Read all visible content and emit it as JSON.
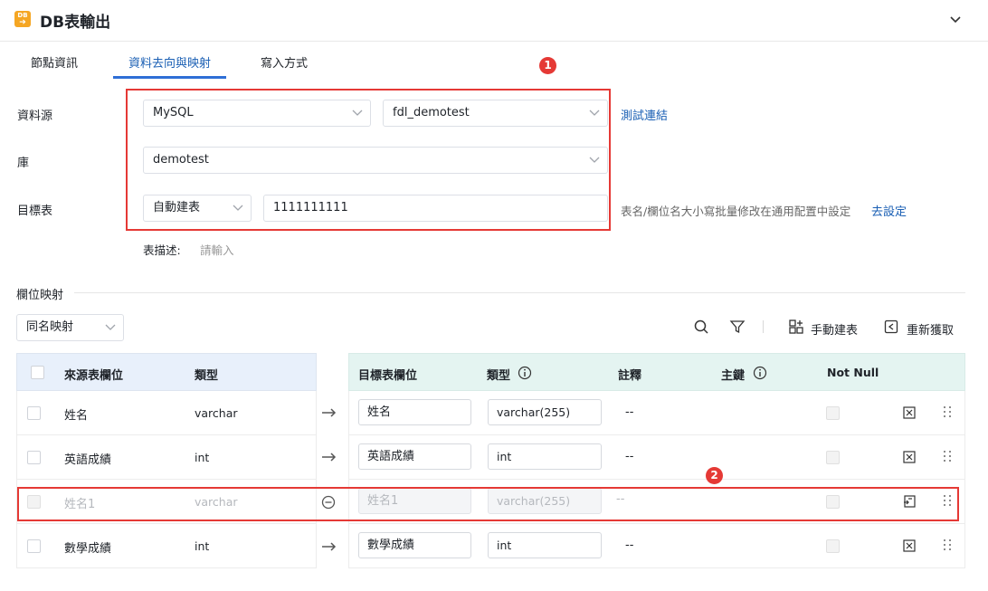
{
  "header": {
    "title": "DB表輸出",
    "logo_text": "DB"
  },
  "tabs": [
    {
      "label": "節點資訊"
    },
    {
      "label": "資料去向與映射"
    },
    {
      "label": "寫入方式"
    }
  ],
  "badges": [
    "1",
    "2"
  ],
  "form": {
    "datasource_label": "資料源",
    "datasource_type": "MySQL",
    "datasource_conn": "fdl_demotest",
    "test_link": "測試連結",
    "db_label": "庫",
    "db_value": "demotest",
    "target_label": "目標表",
    "target_mode": "自動建表",
    "target_name": "1111111111",
    "hint": "表名/欄位名大小寫批量修改在通用配置中設定",
    "goto_link": "去設定",
    "desc_label": "表描述:",
    "desc_placeholder": "請輸入"
  },
  "mapping": {
    "section_title": "欄位映射",
    "mode": "同名映射",
    "manual_create": "手動建表",
    "refetch": "重新獲取"
  },
  "source_table": {
    "headers": [
      "來源表欄位",
      "類型"
    ],
    "rows": [
      {
        "field": "姓名",
        "type": "varchar"
      },
      {
        "field": "英語成績",
        "type": "int"
      },
      {
        "field": "姓名1",
        "type": "varchar"
      },
      {
        "field": "數學成績",
        "type": "int"
      }
    ]
  },
  "target_table": {
    "headers": [
      "目標表欄位",
      "類型",
      "註釋",
      "主鍵",
      "Not Null"
    ],
    "rows": [
      {
        "field": "姓名",
        "type": "varchar(255)",
        "comment": "--"
      },
      {
        "field": "英語成績",
        "type": "int",
        "comment": "--"
      },
      {
        "field": "姓名1",
        "type": "varchar(255)",
        "comment": "--"
      },
      {
        "field": "數學成績",
        "type": "int",
        "comment": "--"
      }
    ]
  },
  "colors": {
    "accent": "#2f6fd6",
    "highlight": "#e53935",
    "src_head": "#e8f0fb",
    "tgt_head": "#e4f4f1"
  }
}
